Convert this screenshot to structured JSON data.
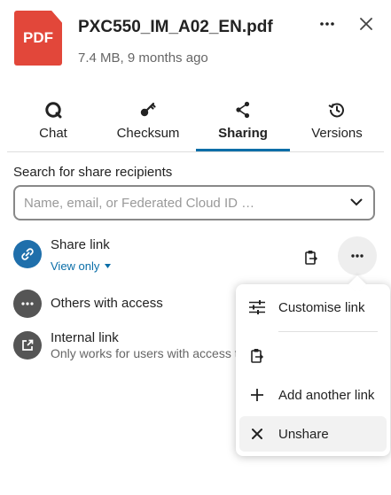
{
  "file": {
    "thumb_label": "PDF",
    "name": "PXC550_IM_A02_EN.pdf",
    "meta": "7.4 MB, 9 months ago"
  },
  "header": {
    "more_icon": "more-horizontal-icon",
    "close_icon": "close-icon"
  },
  "tabs": [
    {
      "label": "Chat",
      "icon": "chat-icon",
      "active": false
    },
    {
      "label": "Checksum",
      "icon": "key-icon",
      "active": false
    },
    {
      "label": "Sharing",
      "icon": "share-icon",
      "active": true
    },
    {
      "label": "Versions",
      "icon": "history-icon",
      "active": false
    }
  ],
  "search": {
    "label": "Search for share recipients",
    "placeholder": "Name, email, or Federated Cloud ID …"
  },
  "share_link": {
    "title": "Share link",
    "permission": "View only"
  },
  "others": {
    "title": "Others with access"
  },
  "internal": {
    "title": "Internal link",
    "subtitle": "Only works for users with access to this file"
  },
  "menu": {
    "items": [
      {
        "label": "Customise link",
        "icon": "tune-icon"
      },
      {
        "label": "",
        "icon": "clipboard-copy-icon"
      },
      {
        "label": "Add another link",
        "icon": "plus-icon"
      },
      {
        "label": "Unshare",
        "icon": "close-icon"
      }
    ]
  },
  "colors": {
    "accent": "#0a6ea8",
    "pdf_red": "#e2473a",
    "link_blue": "#1f6fab",
    "grey_icon": "#555555"
  }
}
